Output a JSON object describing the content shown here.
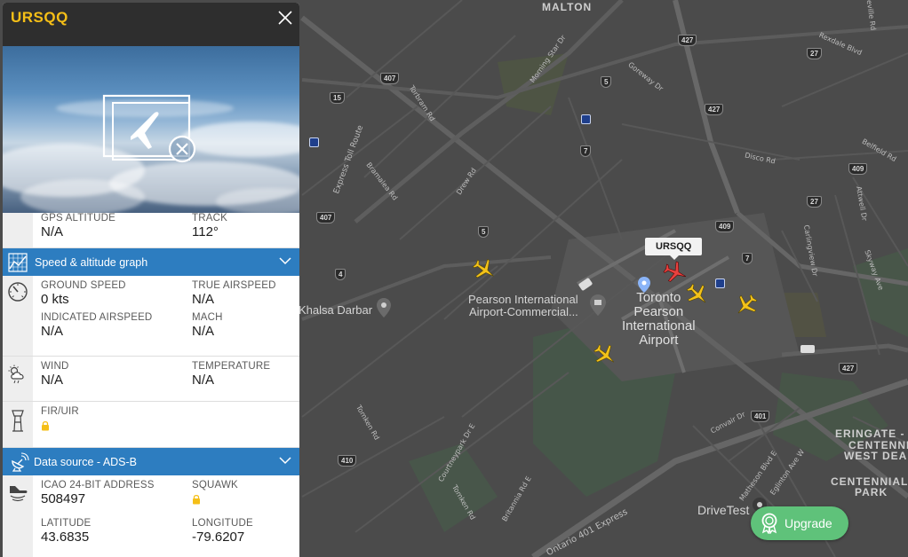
{
  "panel": {
    "title": "URSQQ",
    "photo_icon": "no-aircraft-photo-icon",
    "rows_top": {
      "gps_altitude_label": "GPS ALTITUDE",
      "gps_altitude_value": "N/A",
      "track_label": "TRACK",
      "track_value": "112°"
    },
    "speed_section": {
      "title": "Speed & altitude graph",
      "ground_speed_label": "GROUND SPEED",
      "ground_speed_value": "0 kts",
      "true_airspeed_label": "TRUE AIRSPEED",
      "true_airspeed_value": "N/A",
      "indicated_airspeed_label": "INDICATED AIRSPEED",
      "indicated_airspeed_value": "N/A",
      "mach_label": "MACH",
      "mach_value": "N/A"
    },
    "weather": {
      "wind_label": "WIND",
      "wind_value": "N/A",
      "temperature_label": "TEMPERATURE",
      "temperature_value": "N/A"
    },
    "fir": {
      "label": "FIR/UIR"
    },
    "data_source": {
      "title": "Data source - ADS-B",
      "icao_label": "ICAO 24-BIT ADDRESS",
      "icao_value": "508497",
      "squawk_label": "SQUAWK",
      "latitude_label": "LATITUDE",
      "latitude_value": "43.6835",
      "longitude_label": "LONGITUDE",
      "longitude_value": "-79.6207"
    }
  },
  "map": {
    "selected_callsign": "URSQQ",
    "places": {
      "malton": "MALTON",
      "eringate": "ERINGATE -",
      "centennial_wd": "CENTENNIAL",
      "west_deane": "WEST DEANE",
      "centennial_park": "CENTENNIAL",
      "park": "PARK"
    },
    "pois": {
      "khalsa": "Khalsa Darbar",
      "pearson_commercial_1": "Pearson International",
      "pearson_commercial_2": "Airport-Commercial...",
      "toronto_pearson_1": "Toronto",
      "toronto_pearson_2": "Pearson",
      "toronto_pearson_3": "International",
      "toronto_pearson_4": "Airport",
      "drivetest": "DriveTest"
    },
    "streets": {
      "torbram": "Torbram Rd",
      "morning_star": "Morning Star Dr",
      "goreway": "Goreway Dr",
      "rexdale": "Rexdale Blvd",
      "grenville": "Greville Rd",
      "express_toll": "Express Toll Route",
      "bramalea": "Bramalea Rd",
      "drew": "Drew Rd",
      "disco": "Disco Rd",
      "belfield": "Belfield Rd",
      "attwell": "Attwell Dr",
      "carlingview": "Carlingview Dr",
      "skyway": "Skyway Ave",
      "tomken": "Tomken Rd",
      "courtneypark": "Courtneypark Dr E",
      "britannia": "Britannia Rd E",
      "tomken2": "Tomken Rd",
      "ontario401": "Ontario 401 Express",
      "convair": "Convair Dr",
      "matheson": "Matheson Blvd E",
      "eglinton": "Eglinton Ave W"
    },
    "shields": {
      "s427a": "427",
      "s407a": "407",
      "s15": "15",
      "s5a": "5",
      "s427b": "427",
      "s27a": "27",
      "s7a": "7",
      "s409a": "409",
      "s27b": "27",
      "s407b": "407",
      "s5b": "5",
      "s409b": "409",
      "s7b": "7",
      "s4": "4",
      "s427c": "427",
      "s401": "401",
      "s410": "410"
    }
  },
  "upgrade": {
    "label": "Upgrade"
  },
  "colors": {
    "accent_blue": "#2d7dc0",
    "title_yellow": "#f5bf17",
    "plane_yellow": "#f3c21a",
    "plane_red": "#e8423f",
    "upgrade_green": "#5fc27a"
  }
}
